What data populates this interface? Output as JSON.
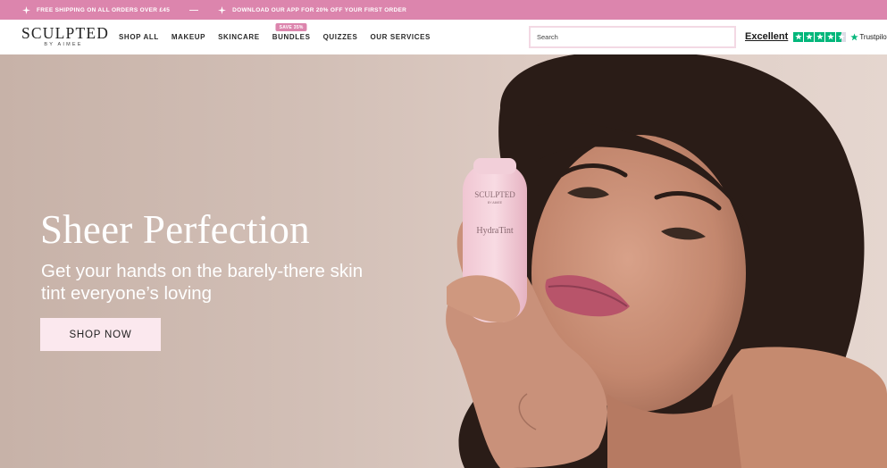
{
  "promo": {
    "items": [
      {
        "text": "FREE SHIPPING ON ALL ORDERS OVER £45",
        "icon": "sparkle-icon"
      },
      {
        "text": "DOWNLOAD OUR APP FOR 20% OFF YOUR FIRST ORDER",
        "icon": "sparkle-icon"
      }
    ],
    "background": "#dc85ad"
  },
  "logo": {
    "main": "SCULPTED",
    "sub": "BY AIMEE"
  },
  "nav": {
    "items": [
      {
        "label": "SHOP ALL"
      },
      {
        "label": "MAKEUP"
      },
      {
        "label": "SKINCARE"
      },
      {
        "label": "BUNDLES",
        "badge": "SAVE 35%"
      },
      {
        "label": "QUIZZES"
      },
      {
        "label": "OUR SERVICES"
      }
    ]
  },
  "search": {
    "placeholder": "Search"
  },
  "trustpilot": {
    "rating_word": "Excellent",
    "stars": 4.5,
    "brand": "Trustpilot",
    "color": "#00b67a"
  },
  "hero": {
    "title": "Sheer Perfection",
    "subtitle": "Get your hands on the barely-there skin tint everyone’s loving",
    "cta_label": "SHOP NOW",
    "product": {
      "brand": "SCULPTED",
      "brand_sub": "BY AIMEE",
      "name": "HydraTint"
    }
  }
}
